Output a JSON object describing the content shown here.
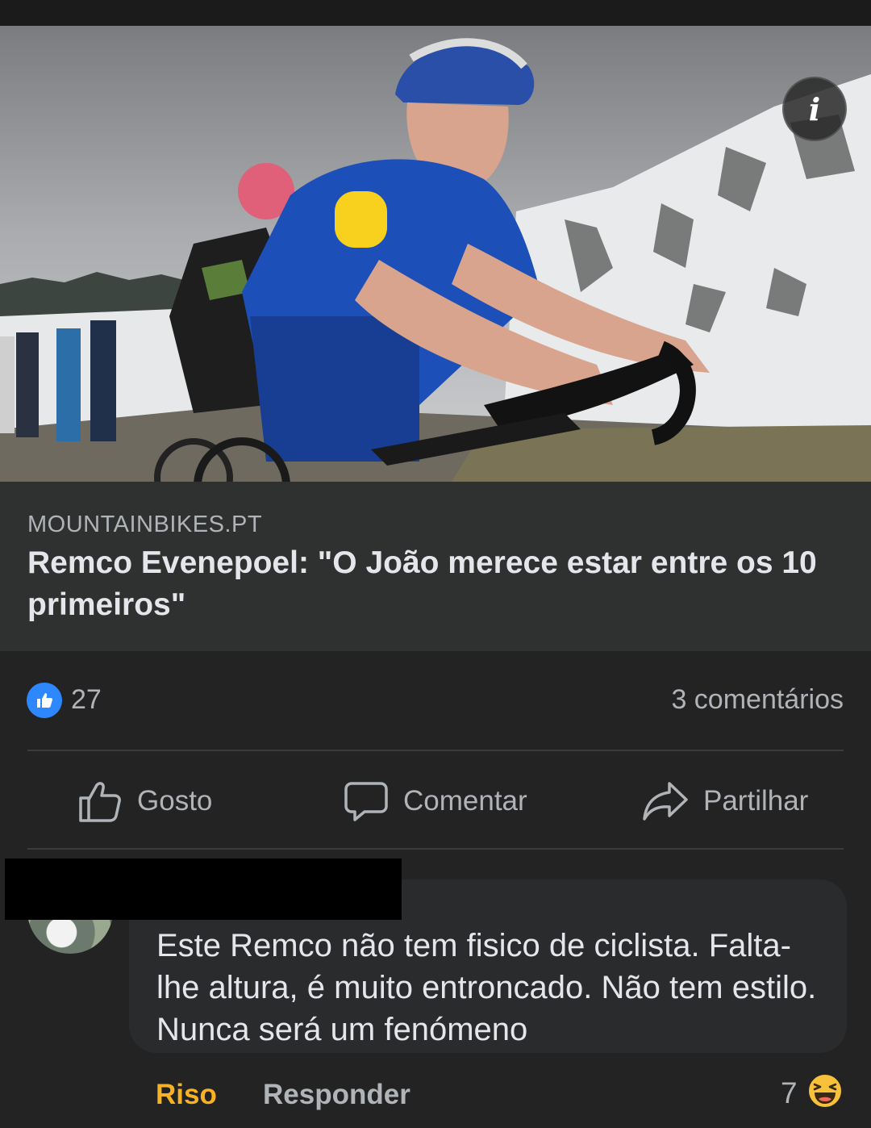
{
  "post": {
    "link_preview": {
      "source": "MOUNTAINBIKES.PT",
      "headline": "Remco Evenepoel: \"O João merece estar entre os 10 primeiros\""
    },
    "info_icon": "info-icon",
    "stats": {
      "likes": "27",
      "comments": "3 comentários"
    },
    "actions": {
      "like": "Gosto",
      "comment": "Comentar",
      "share": "Partilhar"
    }
  },
  "comment": {
    "text": "Este Remco não tem fisico de ciclista. Falta-lhe altura, é muito entroncado. Não tem estilo. Nunca será um fenómeno",
    "reaction_label": "Riso",
    "reply_label": "Responder",
    "reaction_count": "7",
    "reaction_icon": "haha-emoji-icon"
  },
  "colors": {
    "background": "#232323",
    "preview_bg": "#2f3030",
    "like_blue": "#2d88ff",
    "haha_yellow": "#f7b125"
  }
}
